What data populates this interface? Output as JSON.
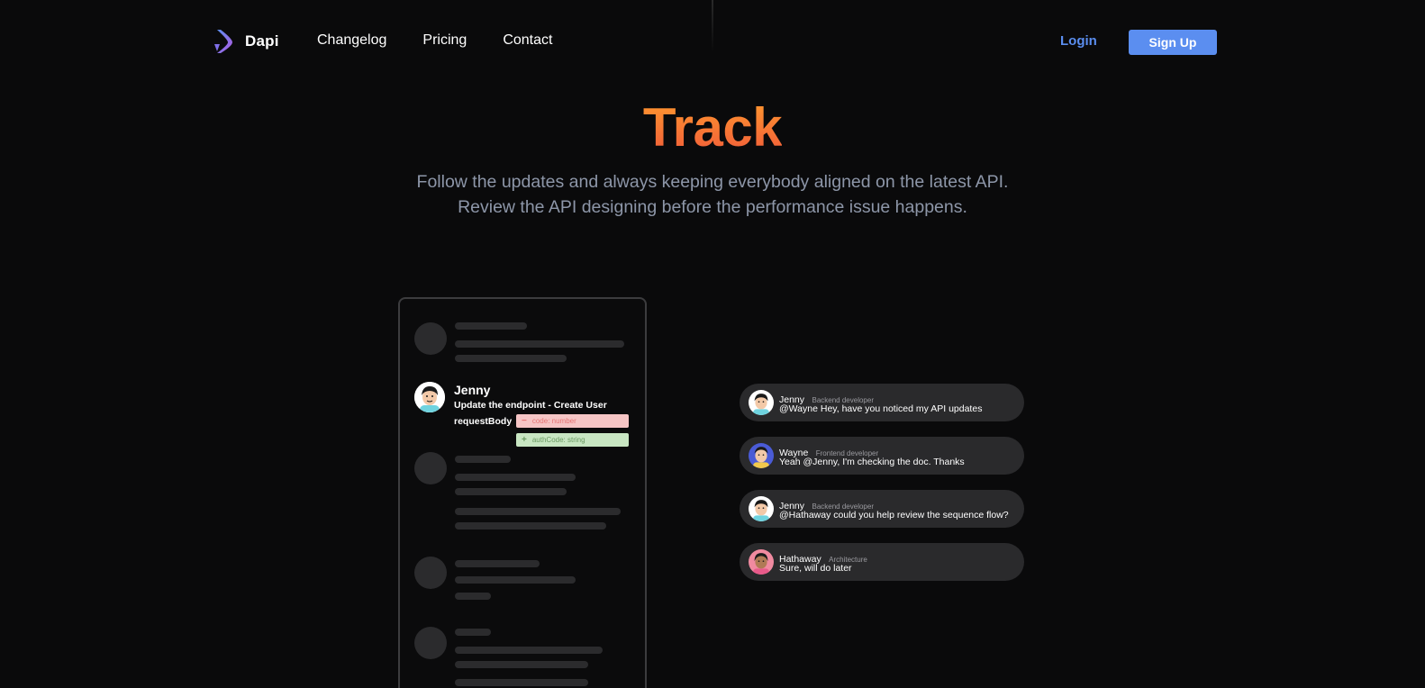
{
  "brand": {
    "name": "Dapi",
    "logo_icon": "chevron-logo-icon",
    "accent": "#5b8ef0"
  },
  "nav": {
    "links": [
      "Changelog",
      "Pricing",
      "Contact"
    ],
    "login": "Login",
    "signup": "Sign Up"
  },
  "hero": {
    "title": "Track",
    "subtitle_line1": "Follow the updates and always keeping everybody aligned on the latest API.",
    "subtitle_line2": "Review the API designing before the performance issue happens."
  },
  "feed": {
    "user": "Jenny",
    "message": "Update the endpoint - Create User",
    "field_label": "requestBody",
    "removed": "code: number",
    "added": "authCode: string"
  },
  "chat": [
    {
      "name": "Jenny",
      "role": "Backend developer",
      "text": "@Wayne  Hey, have you noticed my API updates",
      "avatar": "jenny-avatar-icon"
    },
    {
      "name": "Wayne",
      "role": "Frontend developer",
      "text": "Yeah @Jenny, I'm checking the doc. Thanks",
      "avatar": "wayne-avatar-icon"
    },
    {
      "name": "Jenny",
      "role": "Backend developer",
      "text": "@Hathaway could you help review the sequence flow?",
      "avatar": "jenny-avatar-icon"
    },
    {
      "name": "Hathaway",
      "role": "Architecture",
      "text": "Sure, will do later",
      "avatar": "hathaway-avatar-icon"
    }
  ]
}
